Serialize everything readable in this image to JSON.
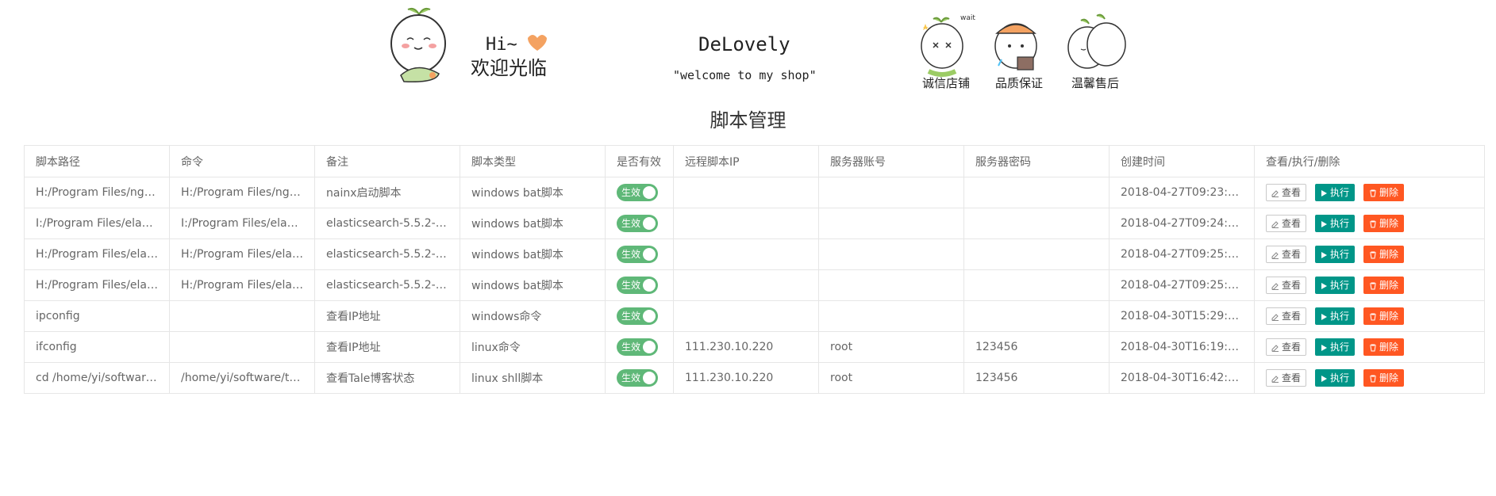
{
  "banner": {
    "greeting": "Hi~",
    "welcome": "欢迎光临",
    "brand": "DeLovely",
    "slogan": "\"welcome to my shop\"",
    "badges": [
      "诚信店铺",
      "品质保证",
      "温馨售后"
    ],
    "sticker_text": "wait"
  },
  "page_title": "脚本管理",
  "table": {
    "headers": [
      "脚本路径",
      "命令",
      "备注",
      "脚本类型",
      "是否有效",
      "远程脚本IP",
      "服务器账号",
      "服务器密码",
      "创建时间",
      "查看/执行/删除"
    ],
    "toggle_label": "生效",
    "actions": {
      "view": "查看",
      "exec": "执行",
      "delete": "删除"
    },
    "rows": [
      {
        "path": "H:/Program Files/ngin...",
        "cmd": "H:/Program Files/ngin...",
        "note": "nainx启动脚本",
        "type": "windows bat脚本",
        "ip": "",
        "account": "",
        "password": "",
        "created": "2018-04-27T09:23:24..."
      },
      {
        "path": "I:/Program Files/elasti...",
        "cmd": "I:/Program Files/elasti...",
        "note": "elasticsearch-5.5.2-no...",
        "type": "windows bat脚本",
        "ip": "",
        "account": "",
        "password": "",
        "created": "2018-04-27T09:24:57..."
      },
      {
        "path": "H:/Program Files/elas...",
        "cmd": "H:/Program Files/elas...",
        "note": "elasticsearch-5.5.2-no...",
        "type": "windows bat脚本",
        "ip": "",
        "account": "",
        "password": "",
        "created": "2018-04-27T09:25:07..."
      },
      {
        "path": "H:/Program Files/elas...",
        "cmd": "H:/Program Files/elas...",
        "note": "elasticsearch-5.5.2-no...",
        "type": "windows bat脚本",
        "ip": "",
        "account": "",
        "password": "",
        "created": "2018-04-27T09:25:18..."
      },
      {
        "path": "ipconfig",
        "cmd": "",
        "note": "查看IP地址",
        "type": "windows命令",
        "ip": "",
        "account": "",
        "password": "",
        "created": "2018-04-30T15:29:58..."
      },
      {
        "path": "ifconfig",
        "cmd": "",
        "note": "查看IP地址",
        "type": "linux命令",
        "ip": "111.230.10.220",
        "account": "root",
        "password": "123456",
        "created": "2018-04-30T16:19:10..."
      },
      {
        "path": "cd /home/yi/software/t...",
        "cmd": "/home/yi/software/tale...",
        "note": "查看Tale博客状态",
        "type": "linux shll脚本",
        "ip": "111.230.10.220",
        "account": "root",
        "password": "123456",
        "created": "2018-04-30T16:42:46..."
      }
    ]
  },
  "colors": {
    "toggle_on": "#5FB878",
    "exec": "#009688",
    "delete": "#FF5722"
  }
}
